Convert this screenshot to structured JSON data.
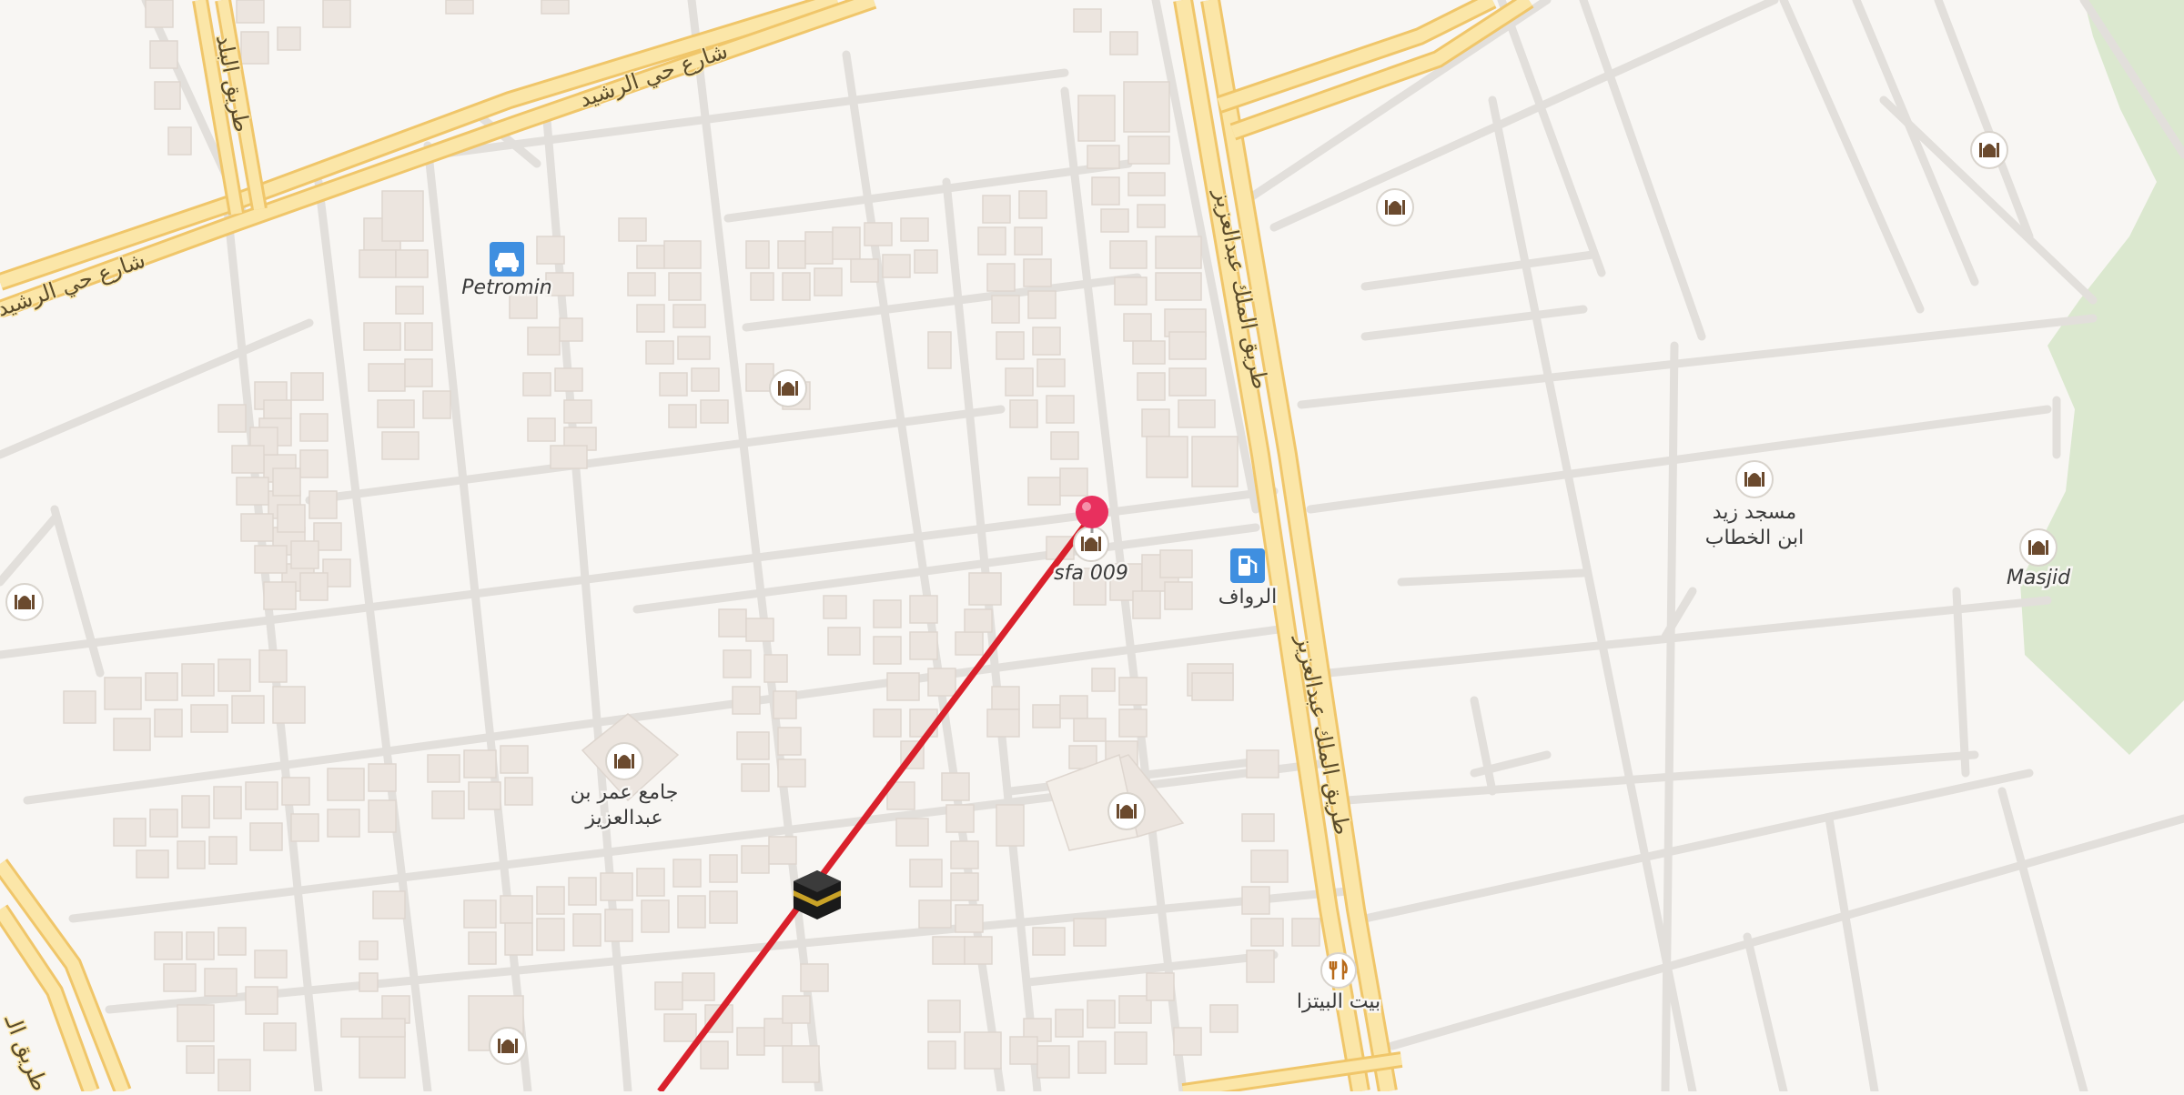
{
  "map": {
    "colors": {
      "background": "#f8f6f3",
      "block_fill": "#f3f0ec",
      "street": "#e4e1dd",
      "main_road_fill": "#fbe6a8",
      "main_road_edge": "#f0c66a",
      "building": "#ece5df",
      "park": "#dbe8cf",
      "route_line": "#d9202b",
      "pin": "#e8305e",
      "poi_circle": "#ffffff",
      "poi_icon": "#6b4a2e",
      "car_badge": "#3f8fe0",
      "fuel_badge": "#3f8fe0"
    },
    "road_labels": {
      "road_nw_a": "شارع حي الرشيد",
      "road_nw_b": "شارع حي الرشيد",
      "road_w_a": "طريق البلد",
      "road_east_a": "طريق الملك عبدالعزيز",
      "road_east_b": "طريق الملك عبدالعزيز",
      "road_sw": "طريق الـ"
    },
    "poi": {
      "petromin": {
        "label": "Petromin",
        "icon": "car-icon"
      },
      "fuel": {
        "label": "الرواف",
        "icon": "fuel-pump-icon"
      },
      "pin": {
        "label": "sfa 009",
        "icon": "location-pin-icon"
      },
      "mosque_zaid": {
        "label_line1": "مسجد زيد",
        "label_line2": "ابن الخطاب",
        "icon": "mosque-icon"
      },
      "masjid_east": {
        "label": "Masjid",
        "icon": "mosque-icon"
      },
      "mosque_omar": {
        "label_line1": "جامع عمر بن",
        "label_line2": "عبدالعزيز",
        "icon": "mosque-icon"
      },
      "pizza": {
        "label": "بيت البيتزا",
        "icon": "fork-knife-icon"
      },
      "kaaba": {
        "icon": "kaaba-icon"
      }
    },
    "route": {
      "description_icon": "qibla-direction-line"
    }
  }
}
